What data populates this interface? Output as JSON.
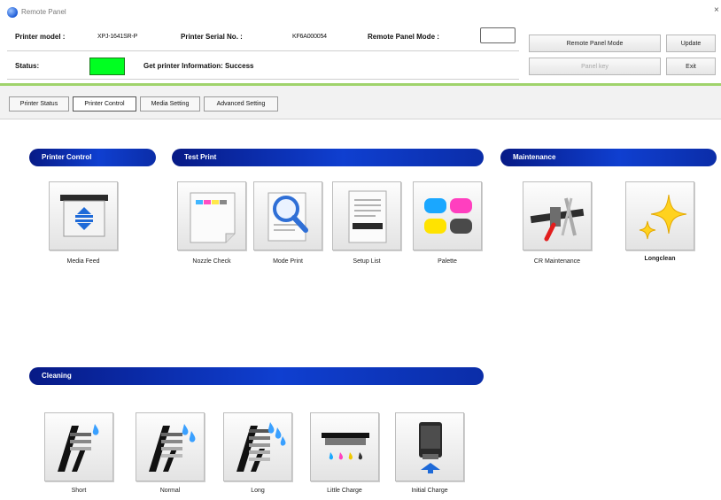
{
  "window": {
    "title": "Remote Panel"
  },
  "header": {
    "printer_model_label": "Printer model :",
    "printer_model_value": "XPJ-1641SR-P",
    "serial_label": "Printer Serial No. :",
    "serial_value": "KF6A000054",
    "remote_panel_mode_label": "Remote Panel Mode :",
    "remote_panel_mode_value": "",
    "status_label": "Status:",
    "status_color": "#00ff21",
    "status_text": "Get printer Information: Success"
  },
  "buttons": {
    "remote_panel_mode": "Remote Panel Mode",
    "update": "Update",
    "panel_key": "Panel key",
    "exit": "Exit"
  },
  "tabs": [
    {
      "label": "Printer Status",
      "active": false
    },
    {
      "label": "Printer Control",
      "active": true
    },
    {
      "label": "Media Setting",
      "active": false
    },
    {
      "label": "Advanced Setting",
      "active": false
    }
  ],
  "sections": {
    "printer_control": {
      "title": "Printer Control",
      "items": [
        {
          "label": "Media Feed",
          "icon": "media-feed-icon"
        }
      ]
    },
    "test_print": {
      "title": "Test Print",
      "items": [
        {
          "label": "Nozzle Check",
          "icon": "nozzle-check-icon"
        },
        {
          "label": "Mode Print",
          "icon": "mode-print-icon"
        },
        {
          "label": "Setup List",
          "icon": "setup-list-icon"
        },
        {
          "label": "Palette",
          "icon": "palette-icon"
        }
      ]
    },
    "maintenance": {
      "title": "Maintenance",
      "items": [
        {
          "label": "CR Maintenance",
          "icon": "cr-maintenance-icon"
        },
        {
          "label": "Longclean",
          "icon": "sparkle-icon"
        }
      ]
    },
    "cleaning": {
      "title": "Cleaning",
      "items": [
        {
          "label": "Short",
          "icon": "cleaning-short-icon"
        },
        {
          "label": "Normal",
          "icon": "cleaning-normal-icon"
        },
        {
          "label": "Long",
          "icon": "cleaning-long-icon"
        },
        {
          "label": "Little Charge",
          "icon": "little-charge-icon"
        },
        {
          "label": "Initial Charge",
          "icon": "initial-charge-icon"
        }
      ]
    }
  },
  "colors": {
    "accent_green": "#9fd36b",
    "section_blue": "#0f3fd0"
  }
}
